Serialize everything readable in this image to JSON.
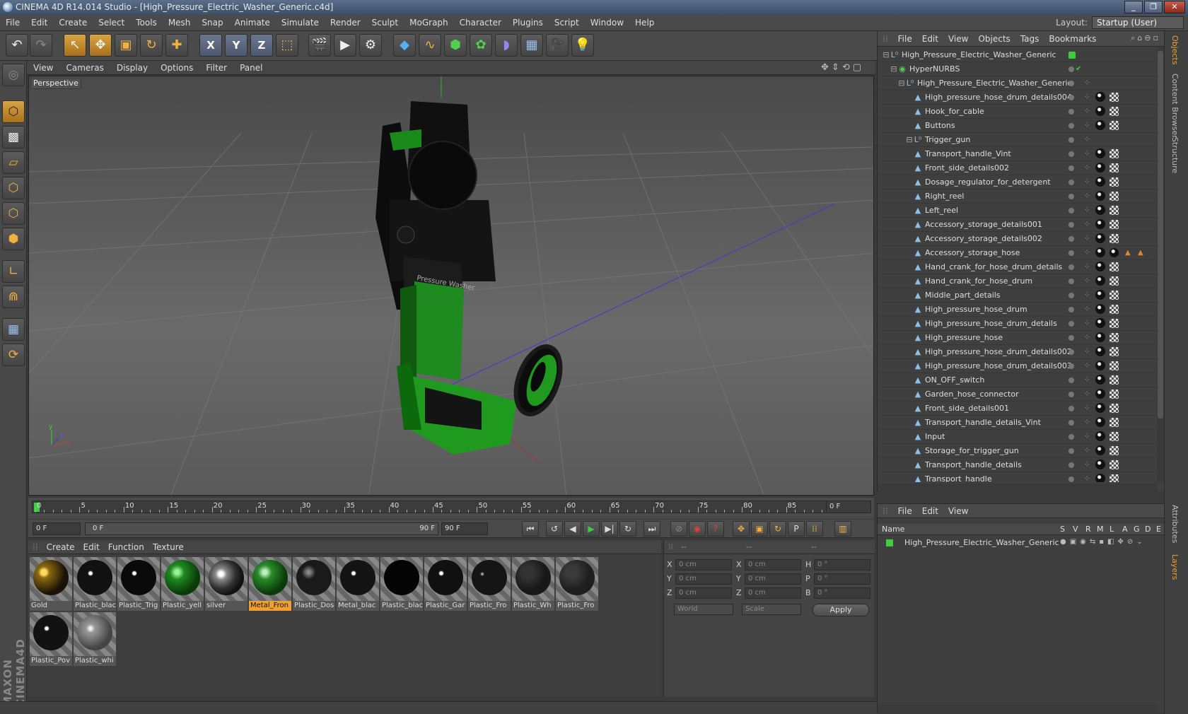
{
  "window": {
    "title": "CINEMA 4D R14.014 Studio - [High_Pressure_Electric_Washer_Generic.c4d]"
  },
  "menubar": {
    "items": [
      "File",
      "Edit",
      "Create",
      "Select",
      "Tools",
      "Mesh",
      "Snap",
      "Animate",
      "Simulate",
      "Render",
      "Sculpt",
      "MoGraph",
      "Character",
      "Plugins",
      "Script",
      "Window",
      "Help"
    ],
    "layout_label": "Layout:",
    "layout_value": "Startup (User)"
  },
  "viewport": {
    "menu": [
      "View",
      "Cameras",
      "Display",
      "Options",
      "Filter",
      "Panel"
    ],
    "label": "Perspective"
  },
  "timeline": {
    "ticks": [
      "0",
      "5",
      "10",
      "15",
      "20",
      "25",
      "30",
      "35",
      "40",
      "45",
      "50",
      "55",
      "60",
      "65",
      "70",
      "75",
      "80",
      "85",
      "90"
    ],
    "current_frame": "0 F"
  },
  "transport": {
    "start": "0 F",
    "range_left": "0 F",
    "range_right": "90 F",
    "end": "90 F"
  },
  "materials": {
    "menu": [
      "Create",
      "Edit",
      "Function",
      "Texture"
    ],
    "items": [
      {
        "name": "Gold",
        "color": "#8a6a10"
      },
      {
        "name": "Plastic_blac",
        "color": "#111111"
      },
      {
        "name": "Plastic_Trig",
        "color": "#0a0a0a"
      },
      {
        "name": "Plastic_yell",
        "color": "#1f8a1f"
      },
      {
        "name": "silver",
        "color": "#555555"
      },
      {
        "name": "Metal_Fron",
        "color": "#2a8a2a"
      },
      {
        "name": "Plastic_Dos",
        "color": "#1a1a1a"
      },
      {
        "name": "Metal_blac",
        "color": "#141414"
      },
      {
        "name": "Plastic_blac",
        "color": "#050505"
      },
      {
        "name": "Plastic_Gar",
        "color": "#101010"
      },
      {
        "name": "Plastic_Fro",
        "color": "#151515"
      },
      {
        "name": "Plastic_Wh",
        "color": "#222222"
      },
      {
        "name": "Plastic_Fro",
        "color": "#2a2a2a"
      },
      {
        "name": "Plastic_Pov",
        "color": "#121212"
      },
      {
        "name": "Plastic_whi",
        "color": "#777777"
      }
    ]
  },
  "coords": {
    "header": [
      "--",
      "--",
      "--"
    ],
    "rows": [
      {
        "a": "X",
        "av": "0 cm",
        "b": "X",
        "bv": "0 cm",
        "c": "H",
        "cv": "0 °"
      },
      {
        "a": "Y",
        "av": "0 cm",
        "b": "Y",
        "bv": "0 cm",
        "c": "P",
        "cv": "0 °"
      },
      {
        "a": "Z",
        "av": "0 cm",
        "b": "Z",
        "bv": "0 cm",
        "c": "B",
        "cv": "0 °"
      }
    ],
    "mode": "World",
    "scale": "Scale",
    "apply": "Apply"
  },
  "objects": {
    "menu": [
      "File",
      "Edit",
      "View",
      "Objects",
      "Tags",
      "Bookmarks"
    ],
    "tree": [
      {
        "name": "High_Pressure_Electric_Washer_Generic",
        "level": 0
      },
      {
        "name": "HyperNURBS",
        "level": 1
      },
      {
        "name": "High_Pressure_Electric_Washer_Generic",
        "level": 2
      },
      {
        "name": "High_pressure_hose_drum_details004",
        "level": 3
      },
      {
        "name": "Hook_for_cable",
        "level": 3
      },
      {
        "name": "Buttons",
        "level": 3
      },
      {
        "name": "Trigger_gun",
        "level": 3
      },
      {
        "name": "Transport_handle_Vint",
        "level": 3
      },
      {
        "name": "Front_side_details002",
        "level": 3
      },
      {
        "name": "Dosage_regulator_for_detergent",
        "level": 3
      },
      {
        "name": "Right_reel",
        "level": 3
      },
      {
        "name": "Left_reel",
        "level": 3
      },
      {
        "name": "Accessory_storage_details001",
        "level": 3
      },
      {
        "name": "Accessory_storage_details002",
        "level": 3
      },
      {
        "name": "Accessory_storage_hose",
        "level": 3
      },
      {
        "name": "Hand_crank_for_hose_drum_details",
        "level": 3
      },
      {
        "name": "Hand_crank_for_hose_drum",
        "level": 3
      },
      {
        "name": "Middle_part_details",
        "level": 3
      },
      {
        "name": "High_pressure_hose_drum",
        "level": 3
      },
      {
        "name": "High_pressure_hose_drum_details",
        "level": 3
      },
      {
        "name": "High_pressure_hose",
        "level": 3
      },
      {
        "name": "High_pressure_hose_drum_details002",
        "level": 3
      },
      {
        "name": "High_pressure_hose_drum_details003",
        "level": 3
      },
      {
        "name": "ON_OFF_switch",
        "level": 3
      },
      {
        "name": "Garden_hose_connector",
        "level": 3
      },
      {
        "name": "Front_side_details001",
        "level": 3
      },
      {
        "name": "Transport_handle_details_Vint",
        "level": 3
      },
      {
        "name": "Input",
        "level": 3
      },
      {
        "name": "Storage_for_trigger_gun",
        "level": 3
      },
      {
        "name": "Transport_handle_details",
        "level": 3
      },
      {
        "name": "Transport_handle",
        "level": 3
      }
    ]
  },
  "layers": {
    "menu": [
      "File",
      "Edit",
      "View"
    ],
    "columns": [
      "Name",
      "S",
      "V",
      "R",
      "M",
      "L",
      "A",
      "G",
      "D",
      "E"
    ],
    "row": "High_Pressure_Electric_Washer_Generic"
  },
  "sidetabs": [
    "Objects",
    "Content Browser",
    "Structure",
    "Attributes",
    "Layers"
  ]
}
